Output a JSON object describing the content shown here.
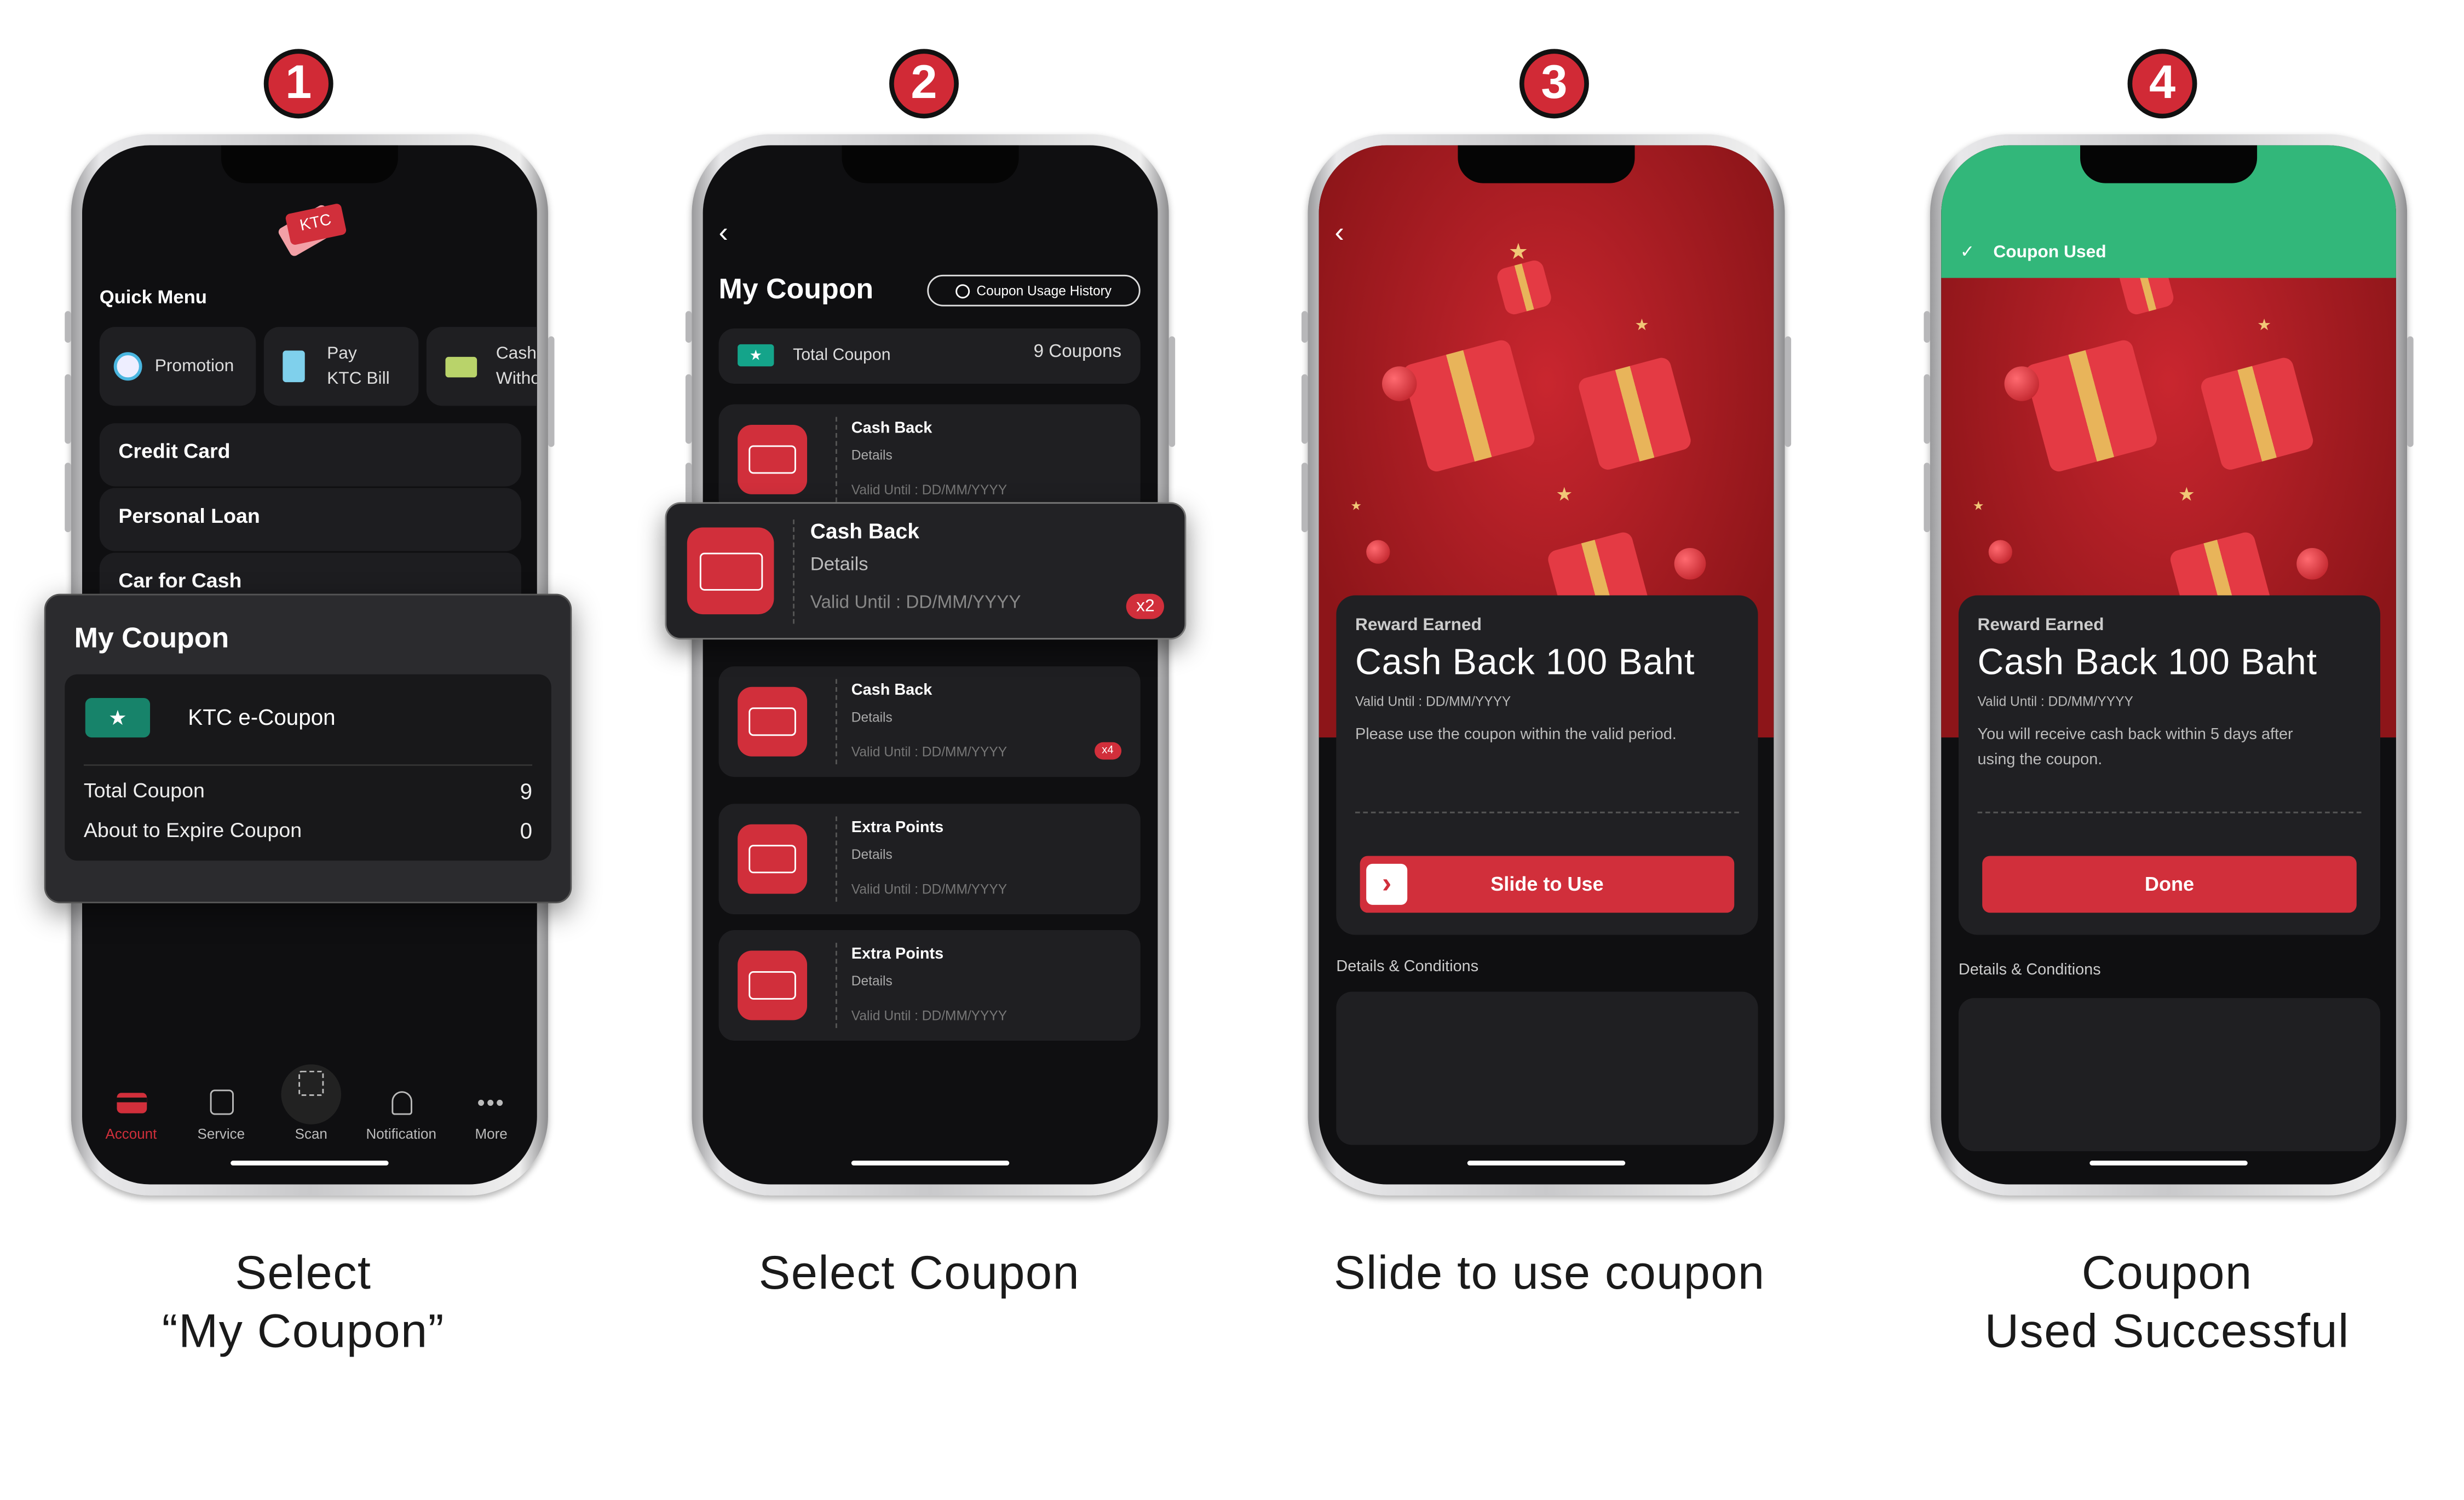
{
  "steps": [
    {
      "number": "1",
      "caption_line1": "Select",
      "caption_line2": "“My Coupon”"
    },
    {
      "number": "2",
      "caption_line1": "Select Coupon",
      "caption_line2": ""
    },
    {
      "number": "3",
      "caption_line1": "Slide to use coupon",
      "caption_line2": ""
    },
    {
      "number": "4",
      "caption_line1": "Coupon",
      "caption_line2": "Used Successful"
    }
  ],
  "colors": {
    "accent_red": "#d12f3b",
    "success_green": "#32b77a",
    "background_dark": "#0f0f11"
  },
  "screen1": {
    "logo_text": "KTC",
    "quick_menu_title": "Quick Menu",
    "quick_menu": [
      {
        "icon": "magnifier-question-icon",
        "label": "Promotion"
      },
      {
        "icon": "receipt-icon",
        "label_line1": "Pay",
        "label_line2": "KTC Bill"
      },
      {
        "icon": "cash-icon",
        "label_line1": "Cash",
        "label_line2": "Witho"
      }
    ],
    "menu_rows": [
      "Credit Card",
      "Personal Loan",
      "Car for Cash"
    ],
    "popup": {
      "title": "My Coupon",
      "item_label": "KTC e-Coupon",
      "total_label": "Total Coupon",
      "total_value": "9",
      "expire_label": "About to Expire Coupon",
      "expire_value": "0"
    },
    "bottom_nav": [
      {
        "icon": "card-icon",
        "label": "Account",
        "active": true
      },
      {
        "icon": "store-icon",
        "label": "Service"
      },
      {
        "icon": "scan-icon",
        "label": "Scan"
      },
      {
        "icon": "bell-icon",
        "label": "Notification"
      },
      {
        "icon": "more-icon",
        "label": "More"
      }
    ]
  },
  "screen2": {
    "title": "My Coupon",
    "history_button": "Coupon Usage History",
    "total_label": "Total Coupon",
    "total_value": "9 Coupons",
    "coupons": [
      {
        "title": "Cash Back",
        "details": "Details",
        "valid": "Valid Until : DD/MM/YYYY",
        "count": ""
      },
      {
        "title": "Cash Back",
        "details": "Details",
        "valid": "Valid Until : DD/MM/YYYY",
        "count": "x2"
      },
      {
        "title": "Cash Back",
        "details": "Details",
        "valid": "Valid Until : DD/MM/YYYY",
        "count": "x4"
      },
      {
        "title": "Extra Points",
        "details": "Details",
        "valid": "Valid Until : DD/MM/YYYY",
        "count": ""
      },
      {
        "title": "Extra Points",
        "details": "Details",
        "valid": "Valid Until : DD/MM/YYYY",
        "count": ""
      }
    ]
  },
  "screen3": {
    "label": "Reward Earned",
    "title": "Cash Back 100 Baht",
    "valid": "Valid Until : DD/MM/YYYY",
    "message": "Please use the coupon within the valid period.",
    "slide_button": "Slide to Use",
    "details_label": "Details & Conditions"
  },
  "screen4": {
    "status_banner": "Coupon Used",
    "label": "Reward Earned",
    "title": "Cash Back 100 Baht",
    "valid": "Valid Until : DD/MM/YYYY",
    "message": "You will receive cash back within 5 days after using the coupon.",
    "done_button": "Done",
    "details_label": "Details & Conditions"
  }
}
